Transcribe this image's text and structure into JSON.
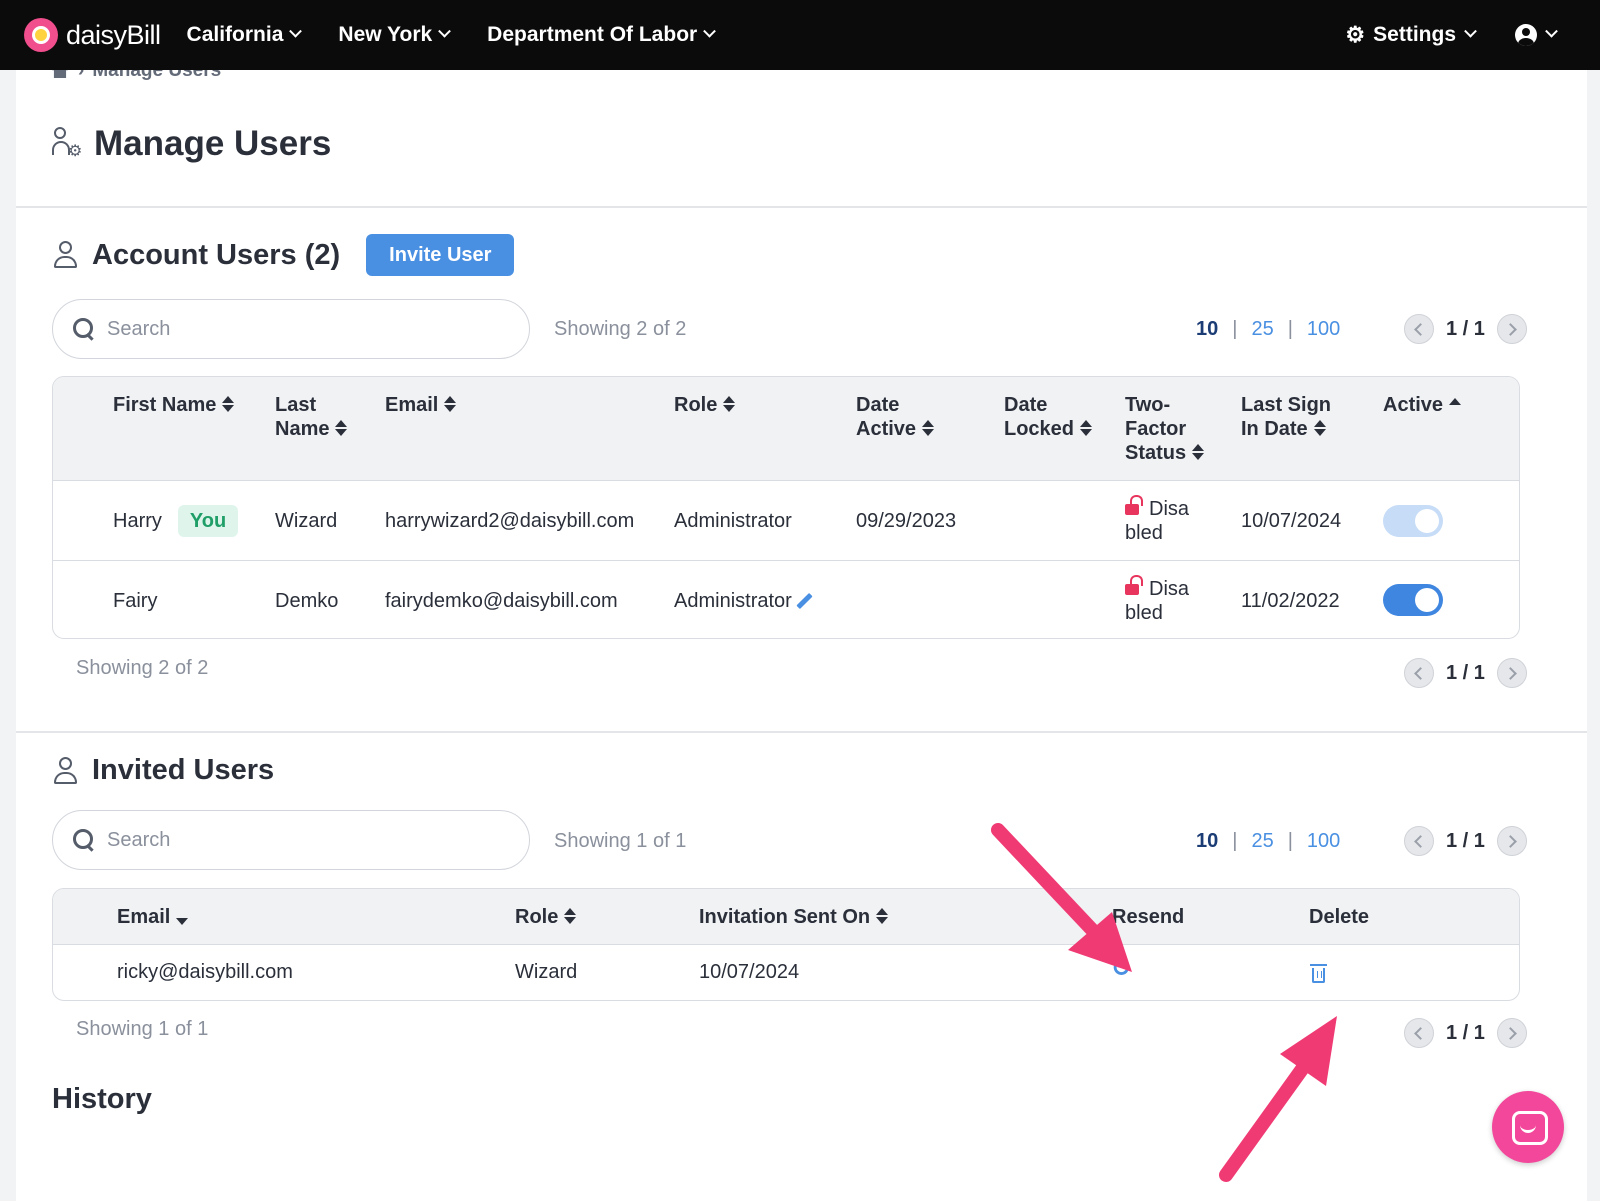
{
  "nav": {
    "brand": "daisyBill",
    "items": [
      {
        "label": "California"
      },
      {
        "label": "New York"
      },
      {
        "label": "Department Of Labor"
      }
    ],
    "settings_label": "Settings"
  },
  "breadcrumb": {
    "current": "Manage Users"
  },
  "page": {
    "title": "Manage Users"
  },
  "account_users": {
    "title": "Account Users (2)",
    "invite_label": "Invite User",
    "search_placeholder": "Search",
    "showing_top": "Showing 2 of 2",
    "showing_bottom": "Showing 2 of 2",
    "page_sizes": [
      "10",
      "25",
      "100"
    ],
    "pager_top": "1 / 1",
    "pager_bottom": "1 / 1",
    "columns": {
      "first_name": "First Name",
      "last_name_1": "Last",
      "last_name_2": "Name",
      "email": "Email",
      "role": "Role",
      "date_active_1": "Date",
      "date_active_2": "Active",
      "date_locked_1": "Date",
      "date_locked_2": "Locked",
      "two_factor_1": "Two-",
      "two_factor_2": "Factor",
      "two_factor_3": "Status",
      "last_sign_1": "Last Sign",
      "last_sign_2": "In Date",
      "active": "Active"
    },
    "rows": [
      {
        "first_name": "Harry",
        "badge": "You",
        "last_name": "Wizard",
        "email": "harrywizard2@daisybill.com",
        "role": "Administrator",
        "date_active": "09/29/2023",
        "date_locked": "",
        "tfa_1": "Disa",
        "tfa_2": "bled",
        "last_sign_in": "10/07/2024",
        "active": true,
        "toggle_color": "#c6dcf7"
      },
      {
        "first_name": "Fairy",
        "last_name": "Demko",
        "email": "fairydemko@daisybill.com",
        "role": "Administrator",
        "date_active": "",
        "date_locked": "",
        "tfa_1": "Disa",
        "tfa_2": "bled",
        "last_sign_in": "11/02/2022",
        "active": true,
        "toggle_color": "#3f86e0"
      }
    ]
  },
  "invited_users": {
    "title": "Invited Users",
    "search_placeholder": "Search",
    "showing_top": "Showing 1 of 1",
    "showing_bottom": "Showing 1 of 1",
    "page_sizes": [
      "10",
      "25",
      "100"
    ],
    "pager_top": "1 / 1",
    "pager_bottom": "1 / 1",
    "columns": {
      "email": "Email",
      "role": "Role",
      "invitation_sent_on": "Invitation Sent On",
      "resend": "Resend",
      "delete": "Delete"
    },
    "rows": [
      {
        "email": "ricky@daisybill.com",
        "role": "Wizard",
        "invitation_sent_on": "10/07/2024"
      }
    ]
  },
  "history": {
    "title": "History"
  },
  "colors": {
    "accent": "#4a90e2",
    "annotation": "#f03a74",
    "chat": "#f2479a"
  }
}
